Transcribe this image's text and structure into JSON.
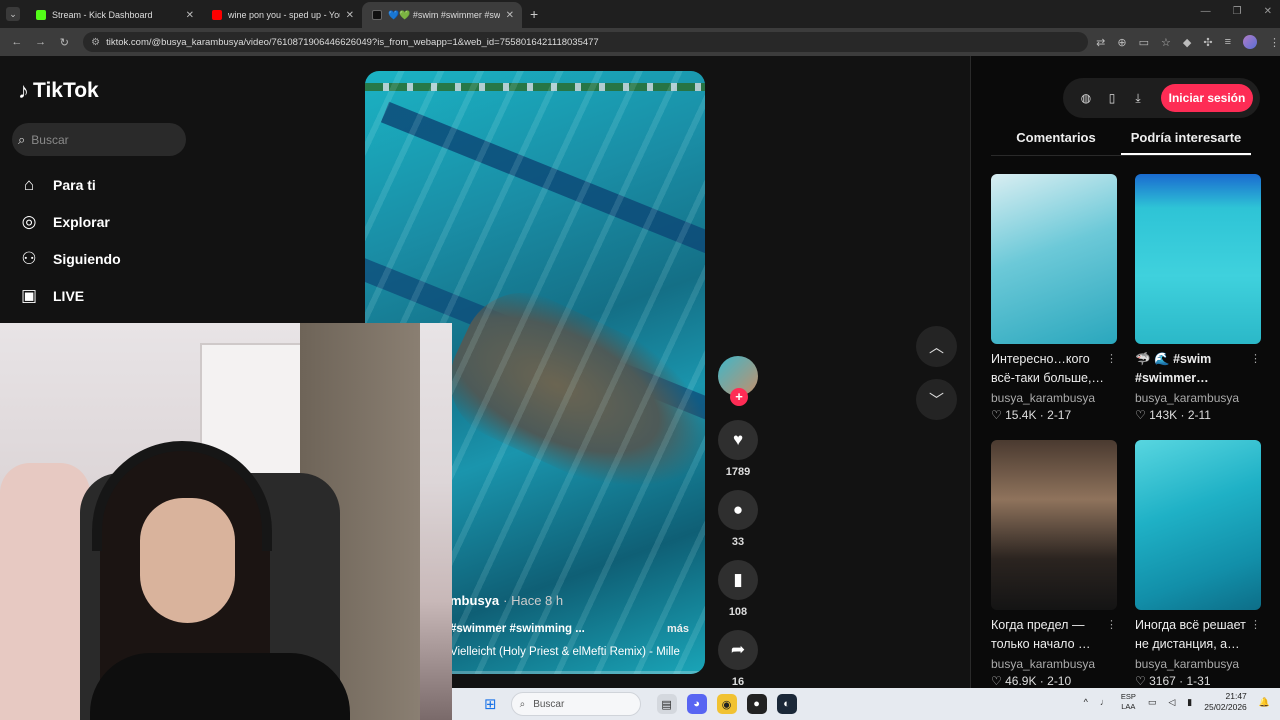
{
  "browser": {
    "tabs": [
      {
        "title": "Stream - Kick Dashboard",
        "fav_color": "#53fc18"
      },
      {
        "title": "wine pon you - sped up - YouT",
        "fav_color": "#ff0000"
      },
      {
        "title": "💙💚 #swim #swimmer #swim",
        "fav_color": "#111111"
      }
    ],
    "new_tab": "+",
    "url": "tiktok.com/@busya_karambusya/video/7610871906446626049?is_from_webapp=1&web_id=7558016421118035477"
  },
  "tiktok": {
    "logo": "TikTok",
    "search_placeholder": "Buscar",
    "nav": [
      {
        "label": "Para ti",
        "icon": "home-icon",
        "glyph": "⌂"
      },
      {
        "label": "Explorar",
        "icon": "compass-icon",
        "glyph": "◎"
      },
      {
        "label": "Siguiendo",
        "icon": "following-icon",
        "glyph": "⚇"
      },
      {
        "label": "LIVE",
        "icon": "live-icon",
        "glyph": "▣"
      }
    ],
    "video": {
      "author_fragment": "mbusya",
      "time": "· Hace 8 h",
      "tags": "#swimmer #swimming ...",
      "more": "más",
      "music": "Vielleicht (Holy Priest & elMefti Remix) - Mille",
      "progress": 0.2
    },
    "actions": {
      "likes": "1789",
      "comments": "33",
      "saves": "108",
      "shares": "16"
    },
    "right": {
      "login": "Iniciar sesión",
      "tabs": [
        "Comentarios",
        "Podría interesarte"
      ],
      "cards": [
        {
          "title": "Интересно…кого всё-таки больше,…",
          "author": "busya_karambusya",
          "likes": "15.4K",
          "date": "2-17"
        },
        {
          "title": "🦈 🌊 #swim #swimmer…",
          "author": "busya_karambusya",
          "likes": "143K",
          "date": "2-11"
        },
        {
          "title": "Когда предел — только начало …",
          "author": "busya_karambusya",
          "likes": "46.9K",
          "date": "2-10"
        },
        {
          "title": "Иногда всё решает не дистанция, а…",
          "author": "busya_karambusya",
          "likes": "3167",
          "date": "1-31"
        }
      ]
    }
  },
  "taskbar": {
    "search": "Buscar",
    "lang1": "ESP",
    "lang2": "LAA",
    "time": "21:47",
    "date": "25/02/2026"
  }
}
